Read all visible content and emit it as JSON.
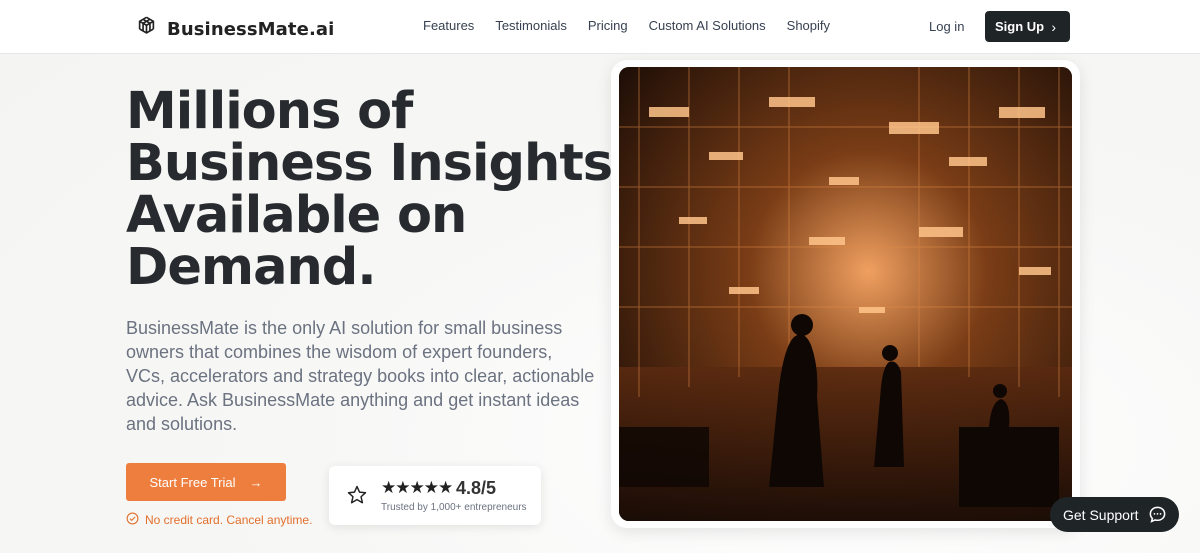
{
  "brand": {
    "name": "BusinessMate.ai",
    "logo_icon": "openai-knot-icon"
  },
  "nav": {
    "items": [
      "Features",
      "Testimonials",
      "Pricing",
      "Custom AI Solutions",
      "Shopify"
    ],
    "login_label": "Log in",
    "signup_label": "Sign Up"
  },
  "hero": {
    "title_lines": [
      "Millions of",
      "Business Insights.",
      "Available on",
      "Demand."
    ],
    "description": "BusinessMate is the only AI solution for small business owners that combines the wisdom of expert founders, VCs, accelerators and strategy books into clear, actionable advice. Ask BusinessMate anything and get instant ideas and solutions.",
    "cta_label": "Start Free Trial",
    "note": "No credit card. Cancel anytime."
  },
  "rating": {
    "stars": "★★★★★",
    "score": "4.8/5",
    "trust_text": "Trusted by 1,000+ entrepreneurs",
    "icon": "star-outline-icon"
  },
  "support": {
    "label": "Get Support",
    "icon": "chat-bubble-icon"
  },
  "colors": {
    "accent": "#ee7e3d",
    "dark_button": "#1f2427",
    "title": "#272b2f",
    "body_text": "#6b7280"
  }
}
